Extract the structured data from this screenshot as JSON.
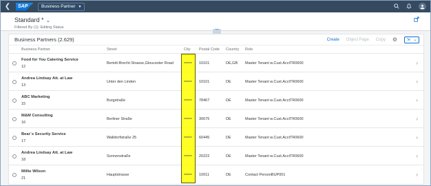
{
  "shell": {
    "logo": "SAP",
    "app_title": "Business Partner",
    "icons": [
      "search-icon",
      "notification-icon",
      "avatar"
    ]
  },
  "header": {
    "variant": "Standard *",
    "filtered_by": "Filtered By (1): Editing Status"
  },
  "table": {
    "title": "Business Partners (2.629)",
    "actions": {
      "create": "Create",
      "object_page": "Object Page",
      "copy": "Copy"
    },
    "columns": [
      "Business Partner",
      "Street",
      "City",
      "Postal Code",
      "Country",
      "Role"
    ],
    "rows": [
      {
        "name": "Food for You Catering Service",
        "id": "12",
        "street": "Bertolt-Brecht-Strasse,Gloucester Road",
        "city": "******",
        "postal_code": "10101",
        "country": "DE,GB",
        "role": "Master Tenant w.Cust.AcctTR0600"
      },
      {
        "name": "Andrea Lindsay Att. at Law",
        "id": "13",
        "street": "Unter den Linden",
        "city": "******",
        "postal_code": "10101",
        "country": "DE",
        "role": "Master Tenant w.Cust.AcctTR0600"
      },
      {
        "name": "ABC Marketing",
        "id": "15",
        "street": "Burgstraße",
        "city": "******",
        "postal_code": "78467",
        "country": "DE",
        "role": "Master Tenant w.Cust.AcctTR0600"
      },
      {
        "name": "M&M Consulting",
        "id": "16",
        "street": "Berliner Straße",
        "city": "******",
        "postal_code": "30675",
        "country": "DE",
        "role": "Master Tenant w.Cust.AcctTR0600"
      },
      {
        "name": "Bear´s Security Service",
        "id": "17",
        "street": "Walldorfstraße 25",
        "city": "******",
        "postal_code": "60445",
        "country": "DE",
        "role": "Master Tenant w.Cust.AcctTR0600"
      },
      {
        "name": "Andrea Lindsay Att. at Law",
        "id": "18",
        "street": "Sonnenstraße",
        "city": "******",
        "postal_code": "20222",
        "country": "DE",
        "role": "Master Tenant w.Cust.AcctTR0600"
      },
      {
        "name": "Millie Wilson",
        "id": "21",
        "street": "Hauptstrasse",
        "city": "******",
        "postal_code": "10011",
        "country": "DE",
        "role": "Contact PersonBUP001"
      }
    ]
  },
  "colors": {
    "shell": "#354a5f",
    "accent": "#0a6ed1",
    "highlight": "#ffff00"
  }
}
